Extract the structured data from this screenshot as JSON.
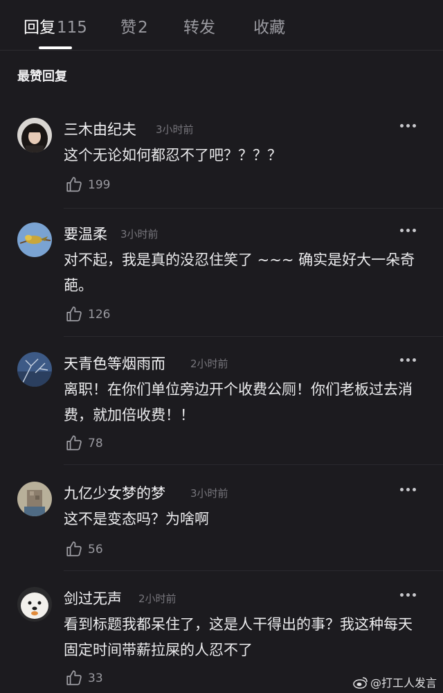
{
  "tabs": [
    {
      "label": "回复",
      "count": "115",
      "active": true
    },
    {
      "label": "赞",
      "count": "2",
      "active": false
    },
    {
      "label": "转发",
      "count": "",
      "active": false
    },
    {
      "label": "收藏",
      "count": "",
      "active": false
    }
  ],
  "section_title": "最赞回复",
  "comments": [
    {
      "user": "三木由纪夫",
      "time": "3小时前",
      "text": "这个无论如何都忍不了吧？？？？",
      "likes": "199",
      "avatar_icon": "girl-portrait-avatar"
    },
    {
      "user": "要温柔",
      "time": "3小时前",
      "text": "对不起，我是真的没忍住笑了 ~~~ 确实是好大一朵奇葩。",
      "likes": "126",
      "avatar_icon": "bird-on-branch-avatar"
    },
    {
      "user": "天青色等烟雨而",
      "time": "2小时前",
      "text": "离职！在你们单位旁边开个收费公厕！你们老板过去消费，就加倍收费！！",
      "likes": "78",
      "avatar_icon": "blue-sky-tree-avatar"
    },
    {
      "user": "九亿少女梦的梦",
      "time": "3小时前",
      "text": "这不是变态吗？为啥啊",
      "likes": "56",
      "avatar_icon": "blurred-child-avatar"
    },
    {
      "user": "剑过无声",
      "time": "2小时前",
      "text": "看到标题我都呆住了，这是人干得出的事？我这种每天固定时间带薪拉屎的人忍不了",
      "likes": "33",
      "avatar_icon": "white-dog-avatar"
    }
  ],
  "watermark": "@打工人发言",
  "colors": {
    "background": "#1c1b1f",
    "text": "#ececee",
    "muted": "#9a9aa0"
  }
}
